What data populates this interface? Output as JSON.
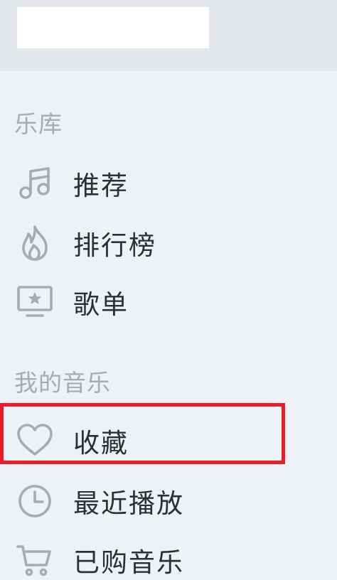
{
  "search": {
    "value": "",
    "placeholder": ""
  },
  "sections": {
    "library": {
      "title": "乐库"
    },
    "my_music": {
      "title": "我的音乐"
    }
  },
  "library_items": [
    {
      "label": "推荐",
      "icon": "music-note-icon"
    },
    {
      "label": "排行榜",
      "icon": "flame-icon"
    },
    {
      "label": "歌单",
      "icon": "playlist-screen-icon"
    }
  ],
  "my_music_items": [
    {
      "label": "收藏",
      "icon": "heart-icon"
    },
    {
      "label": "最近播放",
      "icon": "clock-icon"
    },
    {
      "label": "已购音乐",
      "icon": "cart-icon"
    }
  ],
  "colors": {
    "background": "#eef1f5",
    "header": "#e4e8ec",
    "icon": "#a5acb4",
    "text": "#2d2f33",
    "highlight": "#e81d29"
  }
}
